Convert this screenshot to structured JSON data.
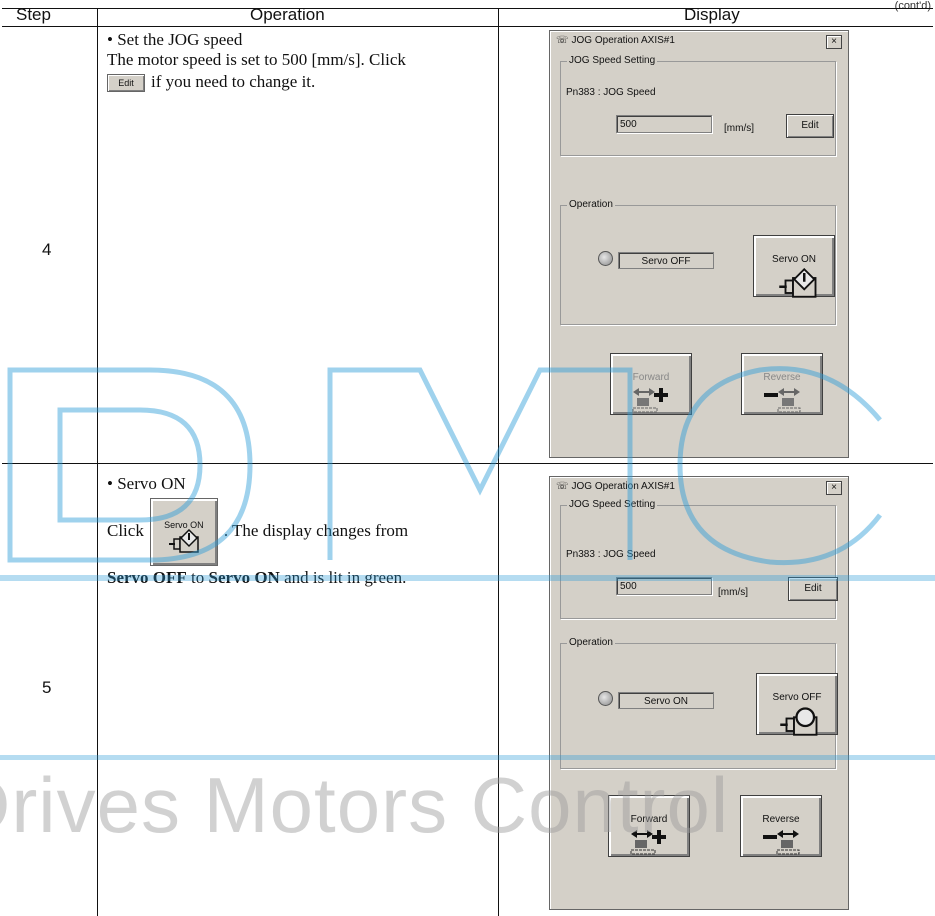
{
  "continued": "(cont'd)",
  "table": {
    "headers": {
      "step": "Step",
      "operation": "Operation",
      "display": "Display"
    }
  },
  "rows": [
    {
      "step": "4",
      "bullet": "• Set the JOG speed",
      "line1": "The motor speed is set to 500 [mm/s]. Click",
      "inline_button": "Edit",
      "line2": "if you need to change it.",
      "dialog": {
        "title": "JOG Operation AXIS#1",
        "close": "×",
        "speed_group": "JOG Speed Setting",
        "param": "Pn383 : JOG Speed",
        "speed_value": "500",
        "unit": "[mm/s]",
        "edit": "Edit",
        "op_group": "Operation",
        "status": "Servo OFF",
        "servo_button": "Servo ON",
        "servo_icon": "servo-on-icon",
        "forward": "Forward",
        "reverse": "Reverse",
        "jog_enabled": false
      }
    },
    {
      "step": "5",
      "bullet": "• Servo ON",
      "click_word": "Click",
      "inline_button": "Servo ON",
      "after_button": ". The display changes from",
      "bold1": "Servo OFF",
      "mid": " to ",
      "bold2": "Servo ON",
      "end": " and is lit in green.",
      "dialog": {
        "title": "JOG Operation AXIS#1",
        "close": "×",
        "speed_group": "JOG Speed Setting",
        "param": "Pn383 : JOG Speed",
        "speed_value": "500",
        "unit": "[mm/s]",
        "edit": "Edit",
        "op_group": "Operation",
        "status": "Servo ON",
        "servo_button": "Servo OFF",
        "servo_icon": "servo-off-icon",
        "forward": "Forward",
        "reverse": "Reverse",
        "jog_enabled": true
      }
    }
  ],
  "watermark": {
    "text": "Drives Motors Control",
    "color": "#2b9bd6"
  }
}
